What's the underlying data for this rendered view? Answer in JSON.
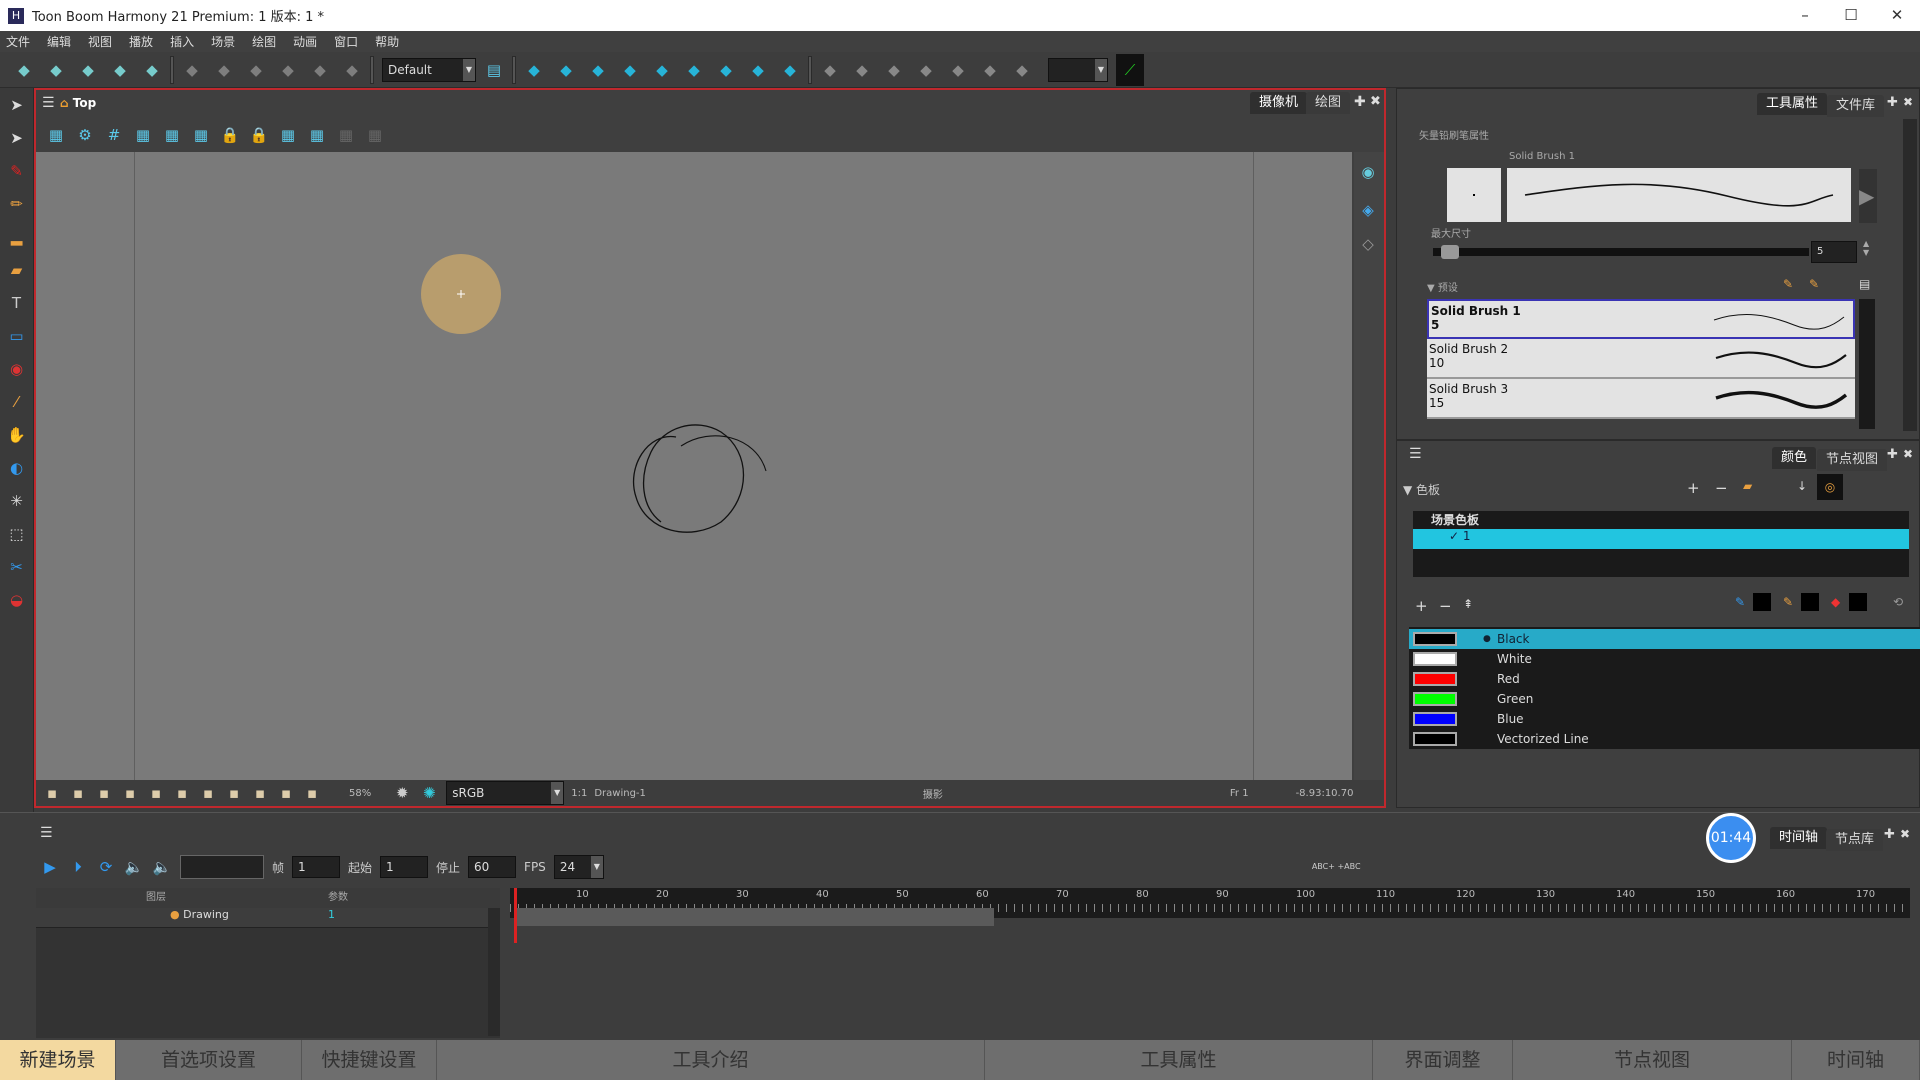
{
  "window": {
    "title": "Toon Boom Harmony 21 Premium: 1 版本: 1 *",
    "minimize": "–",
    "maximize": "☐",
    "close": "✕"
  },
  "menu": [
    "文件",
    "编辑",
    "视图",
    "播放",
    "插入",
    "场景",
    "绘图",
    "动画",
    "窗口",
    "帮助"
  ],
  "toolbar": {
    "workspace": "Default",
    "icons_left": [
      "new-scene-icon",
      "open-icon",
      "save-icon",
      "save-as-icon",
      "export-icon"
    ],
    "icons_undo": [
      "undo-icon",
      "redo-icon",
      "cut-icon",
      "copy-icon",
      "paste-icon",
      "delete-icon"
    ],
    "icons_transform": [
      "layout-icon",
      "translate-icon",
      "rotate-icon",
      "scale-icon",
      "skew-icon",
      "maximize-icon",
      "spline-offset-icon",
      "motion-point-icon",
      "morph-icon"
    ],
    "icons_deform": [
      "rigging-icon",
      "bone-icon",
      "game-bone-icon",
      "envelope-icon",
      "curve-icon",
      "offset-icon",
      "weighted-icon"
    ]
  },
  "left_tools": [
    "select-icon",
    "contour-editor-icon",
    "brush-icon",
    "pencil-icon",
    "stamp-icon",
    "eraser-icon",
    "text-icon",
    "rectangle-icon",
    "paint-icon",
    "dropper-icon",
    "hand-icon",
    "rotate-view-icon",
    "pivot-icon",
    "transform-icon",
    "cutter-icon",
    "ink-icon"
  ],
  "camera": {
    "breadcrumb": "Top",
    "tabs": [
      "摄像机",
      "绘图"
    ],
    "active_tab": 0,
    "tool_icons": [
      "add-drawing-icon",
      "settings-icon",
      "grid-icon",
      "light-table-icon",
      "onion-skin-icon",
      "auto-light-table-icon",
      "lock-icon",
      "lock-add-icon",
      "ruler-icon",
      "perspective-icon",
      "lamp-icon",
      "mirror-icon"
    ],
    "status": {
      "zoom": "58%",
      "color_space": "sRGB",
      "ratio": "1:1",
      "drawing": "Drawing-1",
      "mode": "摄影",
      "frame": "Fr 1",
      "coords": "-8.93:10.70"
    }
  },
  "tool_properties": {
    "tabs": [
      "工具属性",
      "文件库"
    ],
    "active_tab": 0,
    "section": "矢量铅刷笔属性",
    "preview_name": "Solid Brush 1",
    "max_size_label": "最大尺寸",
    "max_size": "5",
    "max_size_fraction": 0.02,
    "presets_label": "预设",
    "presets": [
      {
        "name": "Solid Brush 1",
        "size": "5"
      },
      {
        "name": "Solid Brush 2",
        "size": "10"
      },
      {
        "name": "Solid Brush 3",
        "size": "15"
      }
    ],
    "selected_preset": 0
  },
  "color": {
    "tabs": [
      "颜色",
      "节点视图"
    ],
    "active_tab": 0,
    "palette_label": "色板",
    "palette_group": "场景色板",
    "palette": "1",
    "swatches": [
      {
        "name": "Black",
        "hex": "#000000"
      },
      {
        "name": "White",
        "hex": "#ffffff"
      },
      {
        "name": "Red",
        "hex": "#ff0000"
      },
      {
        "name": "Green",
        "hex": "#00ff00"
      },
      {
        "name": "Blue",
        "hex": "#0000ff"
      },
      {
        "name": "Vectorized Line",
        "hex": "#000000"
      }
    ],
    "selected": 0,
    "accent": "#22c5e0"
  },
  "timeline": {
    "tabs": [
      "时间轴",
      "节点库"
    ],
    "active_tab": 0,
    "clock": "01:44",
    "frame_label": "帧",
    "frame": "1",
    "start_label": "起始",
    "start": "1",
    "stop_label": "停止",
    "stop": "60",
    "fps_label": "FPS",
    "fps": "24",
    "layers_header": "图层",
    "params_header": "参数",
    "layer": {
      "name": "Drawing",
      "param": "1"
    },
    "ruler_ticks": [
      "10",
      "20",
      "30",
      "40",
      "50",
      "60",
      "70",
      "80",
      "90",
      "100",
      "110",
      "120",
      "130",
      "140",
      "150",
      "160",
      "170"
    ],
    "abc_label": "ABC+ +ABC"
  },
  "bottom": [
    "新建场景",
    "首选项设置",
    "快捷键设置",
    "工具介绍",
    "工具属性",
    "界面调整",
    "节点视图",
    "时间轴"
  ]
}
